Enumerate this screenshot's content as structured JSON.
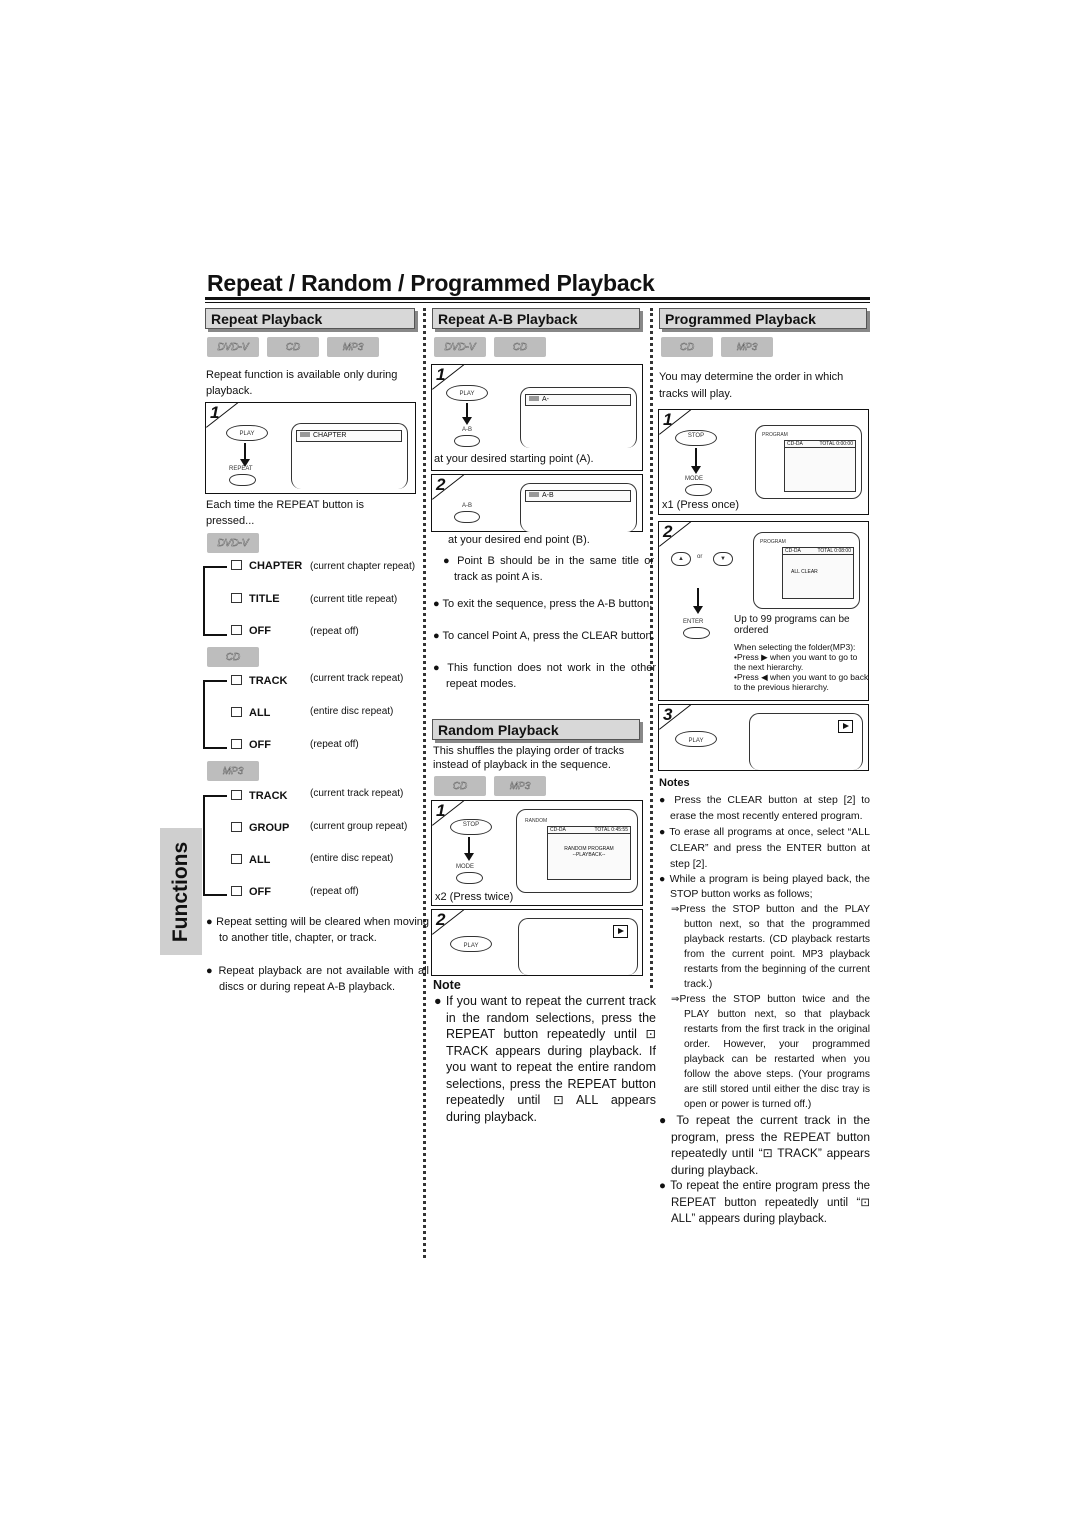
{
  "title": "Repeat / Random / Programmed Playback",
  "side_tab": "Functions",
  "badges": {
    "dvd": "DVD-V",
    "cd": "CD",
    "mp3": "MP3"
  },
  "repeat": {
    "header": "Repeat Playback",
    "intro": "Repeat function is available only during playback.",
    "step1": {
      "num": "1",
      "play": "PLAY",
      "repeat": "REPEAT",
      "screen": "CHAPTER"
    },
    "each_time": "Each time the REPEAT button is pressed...",
    "dvd_modes": [
      {
        "label": "CHAPTER",
        "desc": "(current chapter repeat)"
      },
      {
        "label": "TITLE",
        "desc": "(current title repeat)"
      },
      {
        "label": "OFF",
        "desc": "(repeat off)"
      }
    ],
    "cd_modes": [
      {
        "label": "TRACK",
        "desc": "(current track repeat)"
      },
      {
        "label": "ALL",
        "desc": "(entire disc repeat)"
      },
      {
        "label": "OFF",
        "desc": "(repeat off)"
      }
    ],
    "mp3_modes": [
      {
        "label": "TRACK",
        "desc": "(current track repeat)"
      },
      {
        "label": "GROUP",
        "desc": "(current group repeat)"
      },
      {
        "label": "ALL",
        "desc": "(entire disc repeat)"
      },
      {
        "label": "OFF",
        "desc": "(repeat off)"
      }
    ],
    "bullets": [
      "Repeat setting will be cleared when moving to another title, chapter, or track.",
      "Repeat playback are not available with all discs or during repeat A-B playback."
    ]
  },
  "ab": {
    "header": "Repeat A-B Playback",
    "step1": {
      "num": "1",
      "play": "PLAY",
      "ab": "A-B",
      "screen": "A-",
      "caption": "at your desired starting point (A)."
    },
    "step2": {
      "num": "2",
      "ab": "A-B",
      "screen": "A-B",
      "caption": "at your desired end point (B)."
    },
    "step_note": "Point B should be in the same title or track as point A is.",
    "bullets": [
      "To exit the sequence, press the A-B button.",
      "To cancel Point A, press the CLEAR button.",
      "This function does not work in the other repeat modes."
    ]
  },
  "random": {
    "header": "Random Playback",
    "intro": "This shuffles the playing order of tracks instead of playback in the sequence.",
    "step1": {
      "num": "1",
      "stop": "STOP",
      "mode": "MODE",
      "screen_title": "RANDOM",
      "screen_bar_left": "CD-DA",
      "screen_bar_right": "TOTAL 0:45:55",
      "screen_line1": "RANDOM PROGRAM",
      "screen_line2": "--PLAYBACK--",
      "caption": "x2 (Press twice)"
    },
    "step2": {
      "num": "2",
      "play": "PLAY"
    },
    "note_heading": "Note",
    "note": "If you want to repeat the current track in the random selections, press the REPEAT button repeatedly until ⊡ TRACK appears during playback. If you want to repeat the entire random selections, press the REPEAT button repeatedly until ⊡ ALL appears during playback."
  },
  "program": {
    "header": "Programmed Playback",
    "intro": "You may determine the order in which tracks will play.",
    "step1": {
      "num": "1",
      "stop": "STOP",
      "mode": "MODE",
      "screen_title": "PROGRAM",
      "screen_bar_left": "CD-DA",
      "screen_bar_right": "TOTAL 0:00:00",
      "caption": "x1 (Press once)"
    },
    "step2": {
      "num": "2",
      "or": "or",
      "enter": "ENTER",
      "screen_title": "PROGRAM",
      "screen_bar_left": "CD-DA",
      "screen_bar_right": "TOTAL 0:08:00",
      "all_clear": "ALL CLEAR",
      "text": "Up to 99 programs can be ordered",
      "folder_heading": "When selecting the folder(MP3):",
      "folder_1": "•Press ▶ when you want to go to the next hierarchy.",
      "folder_2": "•Press ◀ when you want to go back to the previous hierarchy."
    },
    "step3": {
      "num": "3",
      "play": "PLAY"
    },
    "notes_heading": "Notes",
    "notes": [
      "Press the CLEAR button at step [2] to erase the most recently entered program.",
      "To erase all programs at once, select “ALL CLEAR” and press the ENTER button at step [2].",
      "While a program is being played back, the STOP button works as follows;"
    ],
    "stop_notes": [
      "⇒Press the STOP button and the PLAY button next, so that the programmed playback restarts. (CD playback restarts from the current point. MP3 playback restarts from the beginning of the current track.)",
      "⇒Press the STOP button twice and the PLAY button next, so that playback restarts from the first track in the original order. However, your programmed playback can be restarted when you follow the above steps. (Your programs are still stored until either the disc tray is open or power is turned off.)"
    ],
    "notes2": [
      "To repeat the current track in the program, press the REPEAT button repeatedly until “⊡ TRACK” appears during playback.",
      "To repeat the entire program press the REPEAT button repeatedly until “⊡ ALL” appears during playback."
    ]
  }
}
